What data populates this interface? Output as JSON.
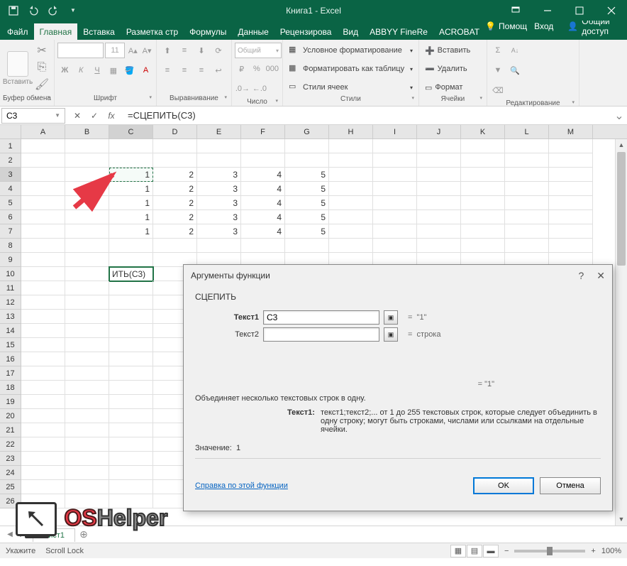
{
  "titlebar": {
    "title": "Книга1 - Excel"
  },
  "tabs": {
    "file": "Файл",
    "items": [
      "Главная",
      "Вставка",
      "Разметка стр",
      "Формулы",
      "Данные",
      "Рецензирова",
      "Вид",
      "ABBYY FineRe",
      "ACROBAT"
    ],
    "active_index": 0,
    "help_placeholder": "Помощ",
    "signin": "Вход",
    "share": "Общий доступ"
  },
  "ribbon": {
    "clipboard": {
      "paste": "Вставить",
      "label": "Буфер обмена"
    },
    "font": {
      "size": "11",
      "label": "Шрифт",
      "bold": "Ж",
      "italic": "К",
      "underline": "Ч"
    },
    "alignment": {
      "label": "Выравнивание"
    },
    "number": {
      "format": "Общий",
      "label": "Число"
    },
    "styles": {
      "cond": "Условное форматирование",
      "table": "Форматировать как таблицу",
      "cell_styles": "Стили ячеек",
      "label": "Стили"
    },
    "cells": {
      "insert": "Вставить",
      "delete": "Удалить",
      "format": "Формат",
      "label": "Ячейки"
    },
    "editing": {
      "label": "Редактирование"
    }
  },
  "formula_bar": {
    "name_box": "C3",
    "formula": "=СЦЕПИТЬ(C3)"
  },
  "grid": {
    "cols": [
      "A",
      "B",
      "C",
      "D",
      "E",
      "F",
      "G",
      "H",
      "I",
      "J",
      "K",
      "L",
      "M"
    ],
    "row_count": 26,
    "data": {
      "3": {
        "C": "1",
        "D": "2",
        "E": "3",
        "F": "4",
        "G": "5"
      },
      "4": {
        "C": "1",
        "D": "2",
        "E": "3",
        "F": "4",
        "G": "5"
      },
      "5": {
        "C": "1",
        "D": "2",
        "E": "3",
        "F": "4",
        "G": "5"
      },
      "6": {
        "C": "1",
        "D": "2",
        "E": "3",
        "F": "4",
        "G": "5"
      },
      "7": {
        "C": "1",
        "D": "2",
        "E": "3",
        "F": "4",
        "G": "5"
      }
    },
    "editing_cell": {
      "row": 10,
      "col": "C",
      "display": "ИТЬ(C3)"
    },
    "marching_cell": {
      "row": 3,
      "col": "C"
    },
    "selected_row_header": 3,
    "selected_col_header": "C"
  },
  "dialog": {
    "title": "Аргументы функции",
    "func": "СЦЕПИТЬ",
    "args": [
      {
        "label": "Текст1",
        "value": "C3",
        "result": "\"1\"",
        "bold": true
      },
      {
        "label": "Текст2",
        "value": "",
        "result": "строка",
        "bold": false
      }
    ],
    "overall_result": "\"1\"",
    "description": "Объединяет несколько текстовых строк в одну.",
    "arg_help_label": "Текст1:",
    "arg_help_text": "текст1;текст2;... от 1 до 255 текстовых строк, которые следует объединить в одну строку; могут быть строками, числами или ссылками на отдельные ячейки.",
    "value_label": "Значение:",
    "value": "1",
    "help_link": "Справка по этой функции",
    "ok": "OK",
    "cancel": "Отмена"
  },
  "sheets": {
    "active": "Лист1"
  },
  "statusbar": {
    "mode": "Укажите",
    "scroll_lock": "Scroll Lock",
    "zoom": "100%"
  },
  "watermark": {
    "os": "OS",
    "helper": "Helper"
  }
}
